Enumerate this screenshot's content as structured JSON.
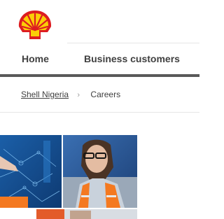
{
  "header": {
    "logo_icon": "shell-pecten-logo-icon",
    "brand_colors": {
      "red": "#dd1d21",
      "yellow": "#fbce07"
    }
  },
  "nav": {
    "items": [
      {
        "label": "Home"
      },
      {
        "label": "Business customers"
      }
    ],
    "divider_color": "#595959"
  },
  "breadcrumb": {
    "items": [
      {
        "label": "Shell Nigeria"
      },
      {
        "label": "Careers"
      }
    ],
    "separator": "›"
  },
  "hero": {
    "image_icon": "careers-hero-image-icon"
  }
}
